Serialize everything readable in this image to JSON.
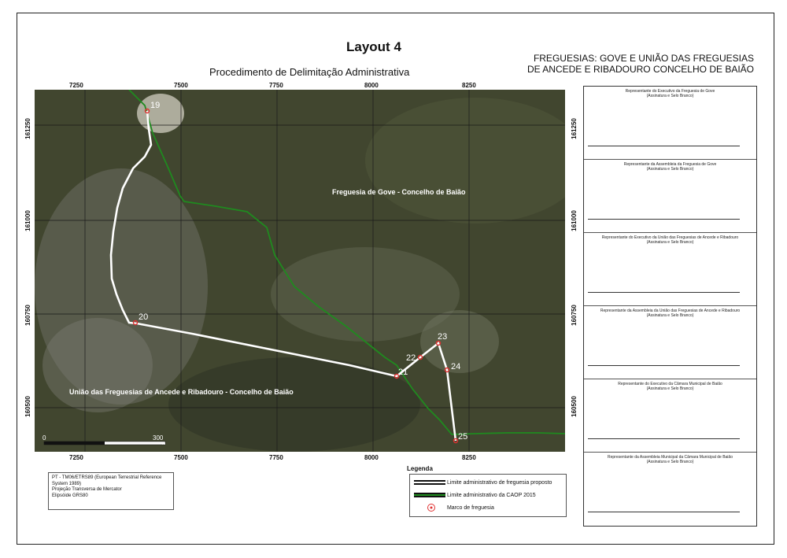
{
  "layout_title": "Layout 4",
  "subtitle": "Procedimento de Delimitação Administrativa",
  "right_title": "FREGUESIAS: GOVE E UNIÃO DAS FREGUESIAS DE ANCEDE E RIBADOURO CONCELHO DE BAIÃO",
  "map": {
    "x_ticks": [
      "7250",
      "7500",
      "7750",
      "8000",
      "8250"
    ],
    "y_ticks": [
      "161250",
      "161000",
      "160750",
      "160500"
    ],
    "regions": [
      "Freguesia de Gove - Concelho de Baião",
      "União das Freguesias de Ancede e Ribadouro - Concelho de Baião"
    ],
    "markers": [
      "19",
      "20",
      "21",
      "22",
      "23",
      "24",
      "25"
    ],
    "scale_start": "0",
    "scale_end": "300",
    "scale_unit": "m",
    "colors": {
      "proposed_line": "#ffffff",
      "caop_line": "#1f8a1f",
      "marker": "#e03030"
    }
  },
  "projection": [
    "PT - TM06/ETRS89 (European Terrestrial Reference System 1989)",
    "Projeção Transversa de Mercator",
    "Elipsóide GRS80"
  ],
  "legend": {
    "title": "Legenda",
    "items": [
      "Limite administrativo de freguesia proposto",
      "Limite administrativo da CAOP 2015",
      "Marco de freguesia"
    ]
  },
  "signatures": [
    "Representante do Executivo da Freguesia de Gove",
    "Representante da Assembleia da Freguesia de Gove",
    "Representante do Executivo da União das Freguesias de Ancede e Ribadouro",
    "Representante da Assembleia da União das Freguesias de Ancede e Ribadouro",
    "Representante do Executivo da Câmara Municipal de Baião",
    "Representante da Assembleia Municipal da Câmara Municipal de Baião"
  ],
  "signature_note": "(Assinatura e Selo Branco)"
}
